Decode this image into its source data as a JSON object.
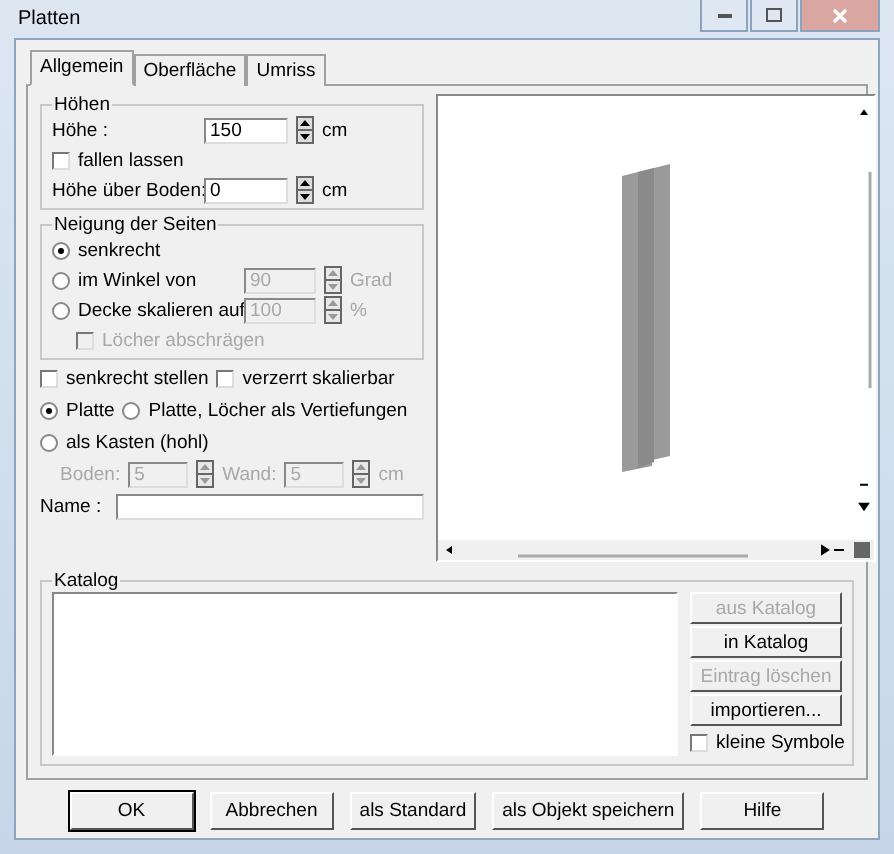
{
  "window": {
    "title": "Platten"
  },
  "tabs": [
    {
      "label": "Allgemein",
      "selected": true
    },
    {
      "label": "Oberfläche",
      "selected": false
    },
    {
      "label": "Umriss",
      "selected": false
    }
  ],
  "heights_group": {
    "title": "Höhen",
    "height": {
      "label": "Höhe :",
      "value": "150",
      "unit": "cm"
    },
    "drop": {
      "label": "fallen lassen",
      "checked": false
    },
    "above_floor": {
      "label": "Höhe über Boden:",
      "value": "0",
      "unit": "cm"
    }
  },
  "slope_group": {
    "title": "Neigung der Seiten",
    "options": [
      {
        "label": "senkrecht",
        "selected": true
      },
      {
        "label": "im Winkel von",
        "selected": false,
        "field": {
          "value": "90",
          "unit": "Grad",
          "disabled": true
        }
      },
      {
        "label": "Decke skalieren auf",
        "selected": false,
        "field": {
          "value": "100",
          "unit": "%",
          "disabled": true
        }
      }
    ],
    "bevel": {
      "label": "Löcher abschrägen",
      "checked": false,
      "disabled": true
    }
  },
  "flags": [
    {
      "label": "senkrecht stellen",
      "checked": false
    },
    {
      "label": "verzerrt skalierbar",
      "checked": false
    }
  ],
  "shape": [
    {
      "label": "Platte",
      "selected": true
    },
    {
      "label": "Platte, Löcher als Vertiefungen",
      "selected": false
    },
    {
      "label": "als Kasten (hohl)",
      "selected": false
    }
  ],
  "box_fields": {
    "disabled": true,
    "fields": [
      {
        "label": "Boden:",
        "value": "5"
      },
      {
        "label": "Wand:",
        "value": "5",
        "unit": "cm"
      }
    ]
  },
  "name": {
    "label": "Name :"
  },
  "catalog": {
    "title": "Katalog",
    "buttons": [
      {
        "label": "aus Katalog",
        "disabled": true
      },
      {
        "label": "in Katalog",
        "disabled": false
      },
      {
        "label": "Eintrag löschen",
        "disabled": true
      },
      {
        "label": "importieren...",
        "disabled": false
      }
    ],
    "small_icons": {
      "label": "kleine Symbole",
      "checked": false
    }
  },
  "buttons": [
    {
      "label": "OK",
      "default": true
    },
    {
      "label": "Abbrechen",
      "default": false
    },
    {
      "label": "als Standard",
      "default": false
    },
    {
      "label": "als Objekt speichern",
      "default": false
    },
    {
      "label": "Hilfe",
      "default": false
    }
  ]
}
